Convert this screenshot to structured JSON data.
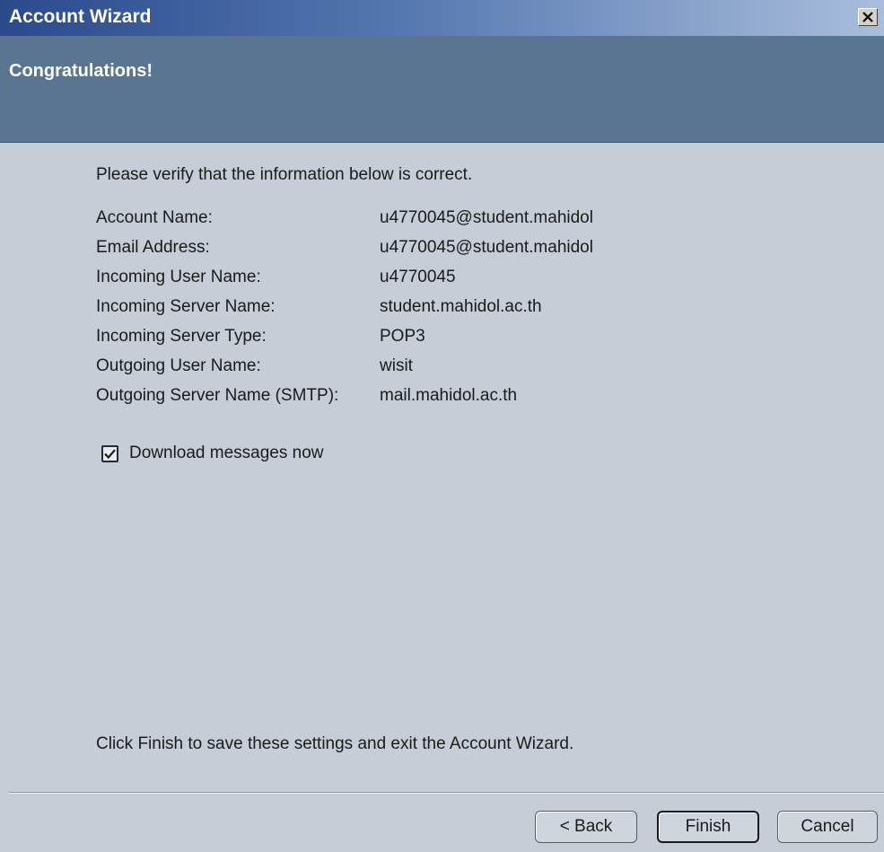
{
  "window": {
    "title": "Account Wizard",
    "close_glyph": "×"
  },
  "header": {
    "title": "Congratulations!"
  },
  "intro": "Please verify that the information below is correct.",
  "details": [
    {
      "label": "Account Name:",
      "value": "u4770045@student.mahidol"
    },
    {
      "label": "Email Address:",
      "value": "u4770045@student.mahidol"
    },
    {
      "label": "Incoming User Name:",
      "value": "u4770045"
    },
    {
      "label": "Incoming Server Name:",
      "value": "student.mahidol.ac.th"
    },
    {
      "label": "Incoming Server Type:",
      "value": "POP3"
    },
    {
      "label": "Outgoing User Name:",
      "value": "wisit"
    },
    {
      "label": "Outgoing Server Name (SMTP):",
      "value": "mail.mahidol.ac.th"
    }
  ],
  "download": {
    "label": "Download messages now",
    "checked": true
  },
  "footer_text": "Click Finish to save these settings and exit the Account Wizard.",
  "buttons": {
    "back": "< Back",
    "finish": "Finish",
    "cancel": "Cancel"
  },
  "colors": {
    "titlebar_start": "#2a4a8c",
    "header_band": "#5a7591",
    "dialog_bg": "#c6cdd6"
  }
}
